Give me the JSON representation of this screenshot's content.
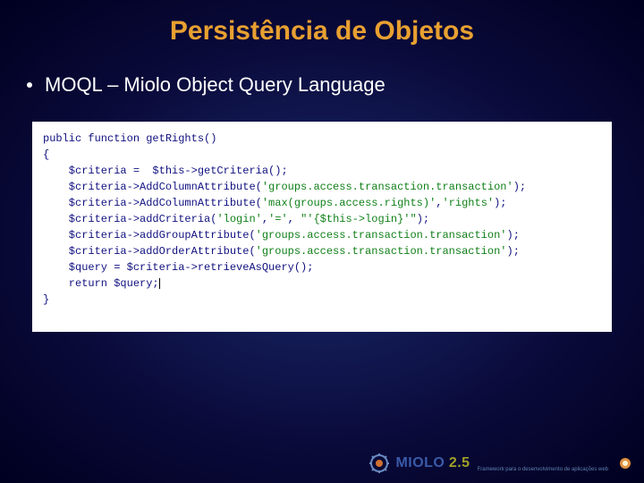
{
  "title": "Persistência de Objetos",
  "bullet": "MOQL – Miolo Object Query Language",
  "code": {
    "l1": "public function getRights()",
    "l2": "{",
    "l3a": "    $criteria =  $this->getCriteria();",
    "l4a": "    $criteria->AddColumnAttribute(",
    "l4s": "'groups.access.transaction.transaction'",
    "l4b": ");",
    "l5a": "    $criteria->AddColumnAttribute(",
    "l5s1": "'max(groups.access.rights)'",
    "l5m": ",",
    "l5s2": "'rights'",
    "l5b": ");",
    "l6a": "    $criteria->addCriteria(",
    "l6s1": "'login'",
    "l6m1": ",",
    "l6s2": "'='",
    "l6m2": ", ",
    "l6s3": "\"'{$this->login}'\"",
    "l6b": ");",
    "l7a": "    $criteria->addGroupAttribute(",
    "l7s": "'groups.access.transaction.transaction'",
    "l7b": ");",
    "l8a": "    $criteria->addOrderAttribute(",
    "l8s": "'groups.access.transaction.transaction'",
    "l8b": ");",
    "l9": "    $query = $criteria->retrieveAsQuery();",
    "l10": "    return $query;",
    "l11": "}"
  },
  "logo": {
    "name": "MIOLO",
    "version": "2.5",
    "tagline": "Framework para o desenvolvimento de aplicações web"
  }
}
